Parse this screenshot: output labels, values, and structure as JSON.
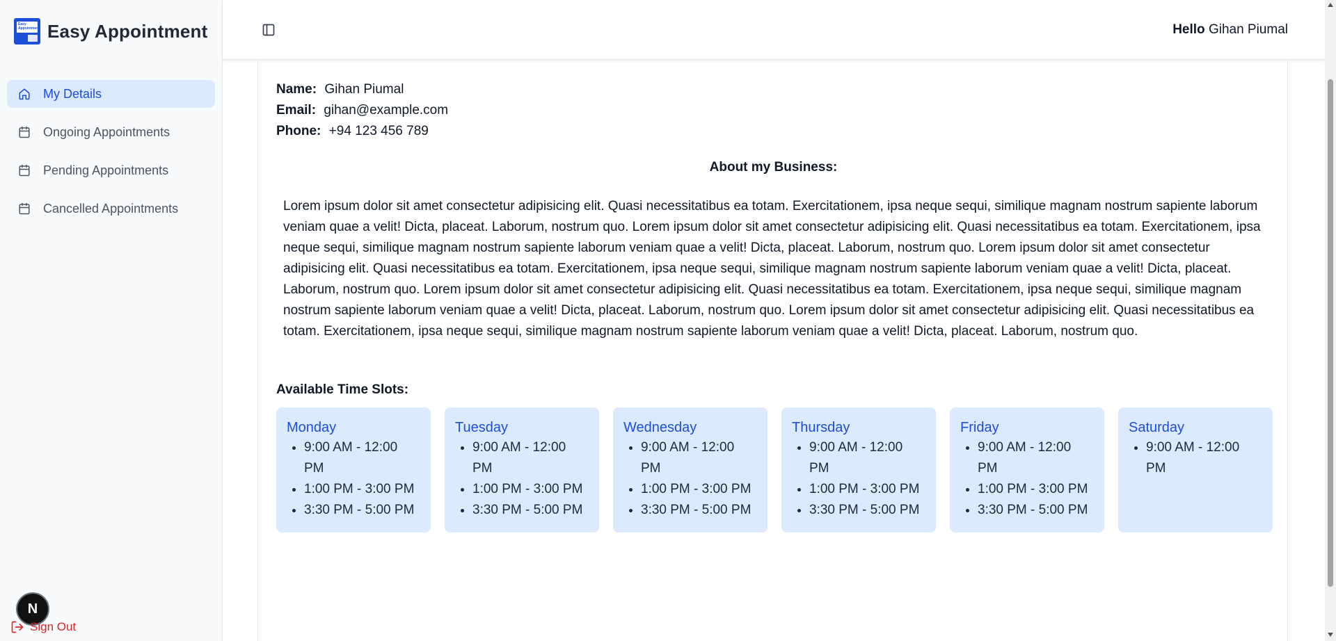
{
  "app": {
    "title": "Easy Appointment",
    "logo_text": "Easy Appointment"
  },
  "sidebar": {
    "items": [
      {
        "label": "My Details",
        "icon": "home-icon",
        "active": true
      },
      {
        "label": "Ongoing Appointments",
        "icon": "calendar-icon",
        "active": false
      },
      {
        "label": "Pending Appointments",
        "icon": "calendar-icon",
        "active": false
      },
      {
        "label": "Cancelled Appointments",
        "icon": "calendar-icon",
        "active": false
      }
    ],
    "fab_letter": "N",
    "signout_label": "Sign Out"
  },
  "header": {
    "greeting": "Hello",
    "user_name": "Gihan Piumal"
  },
  "profile": {
    "name_label": "Name:",
    "name": "Gihan Piumal",
    "email_label": "Email:",
    "email": "gihan@example.com",
    "phone_label": "Phone:",
    "phone": "+94 123 456 789"
  },
  "about": {
    "title": "About my Business:",
    "text": "Lorem ipsum dolor sit amet consectetur adipisicing elit. Quasi necessitatibus ea totam. Exercitationem, ipsa neque sequi, similique magnam nostrum sapiente laborum veniam quae a velit! Dicta, placeat. Laborum, nostrum quo. Lorem ipsum dolor sit amet consectetur adipisicing elit. Quasi necessitatibus ea totam. Exercitationem, ipsa neque sequi, similique magnam nostrum sapiente laborum veniam quae a velit! Dicta, placeat. Laborum, nostrum quo. Lorem ipsum dolor sit amet consectetur adipisicing elit. Quasi necessitatibus ea totam. Exercitationem, ipsa neque sequi, similique magnam nostrum sapiente laborum veniam quae a velit! Dicta, placeat. Laborum, nostrum quo. Lorem ipsum dolor sit amet consectetur adipisicing elit. Quasi necessitatibus ea totam. Exercitationem, ipsa neque sequi, similique magnam nostrum sapiente laborum veniam quae a velit! Dicta, placeat. Laborum, nostrum quo. Lorem ipsum dolor sit amet consectetur adipisicing elit. Quasi necessitatibus ea totam. Exercitationem, ipsa neque sequi, similique magnam nostrum sapiente laborum veniam quae a velit! Dicta, placeat. Laborum, nostrum quo."
  },
  "slots": {
    "title": "Available Time Slots:",
    "days": [
      {
        "day": "Monday",
        "times": [
          "9:00 AM - 12:00 PM",
          "1:00 PM - 3:00 PM",
          "3:30 PM - 5:00 PM"
        ]
      },
      {
        "day": "Tuesday",
        "times": [
          "9:00 AM - 12:00 PM",
          "1:00 PM - 3:00 PM",
          "3:30 PM - 5:00 PM"
        ]
      },
      {
        "day": "Wednesday",
        "times": [
          "9:00 AM - 12:00 PM",
          "1:00 PM - 3:00 PM",
          "3:30 PM - 5:00 PM"
        ]
      },
      {
        "day": "Thursday",
        "times": [
          "9:00 AM - 12:00 PM",
          "1:00 PM - 3:00 PM",
          "3:30 PM - 5:00 PM"
        ]
      },
      {
        "day": "Friday",
        "times": [
          "9:00 AM - 12:00 PM",
          "1:00 PM - 3:00 PM",
          "3:30 PM - 5:00 PM"
        ]
      },
      {
        "day": "Saturday",
        "times": [
          "9:00 AM - 12:00 PM"
        ]
      }
    ]
  },
  "colors": {
    "accent": "#1d4ed8",
    "accent_bg": "#dbeafe",
    "danger": "#dc2626"
  }
}
